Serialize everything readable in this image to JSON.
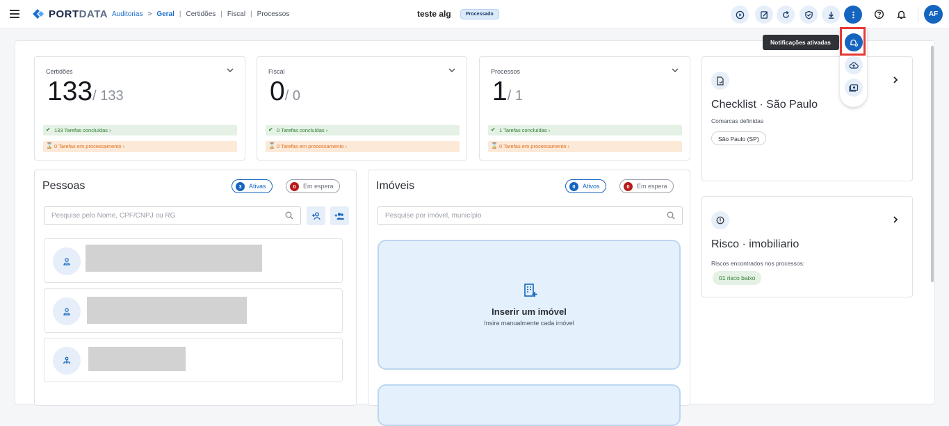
{
  "header": {
    "logo": {
      "part1": "PORT",
      "part2": "DATA"
    },
    "breadcrumb": [
      "Auditorias",
      ">",
      "Geral",
      "|",
      "Certidões",
      "|",
      "Fiscal",
      "|",
      "Processos"
    ],
    "page_title": "teste alg",
    "status_badge": "Processado",
    "avatar": "AF",
    "actions": [
      "play-icon",
      "edit-note-icon",
      "refresh-icon",
      "shield-check-icon",
      "download-icon",
      "more-vertical-icon",
      "help-icon",
      "bell-icon"
    ]
  },
  "tooltip": "Notificações ativadas",
  "stats": [
    {
      "label": "Certidões",
      "value": "133",
      "total": "/ 133",
      "done": "133 Tarefas concluídas",
      "processing": "0 Tarefas em processamento"
    },
    {
      "label": "Fiscal",
      "value": "0",
      "total": "/ 0",
      "done": "0 Tarefas concluídas",
      "processing": "0 Tarefas em processamento"
    },
    {
      "label": "Processos",
      "value": "1",
      "total": "/ 1",
      "done": "1 Tarefas concluídas",
      "processing": "0 Tarefas em processamento"
    }
  ],
  "pessoas": {
    "title": "Pessoas",
    "active_count": "3",
    "active_label": "Ativas",
    "waiting_count": "0",
    "waiting_label": "Em espera",
    "search_placeholder": "Pesquise pelo Nome, CPF/CNPJ ou RG"
  },
  "imoveis": {
    "title": "Imóveis",
    "active_count": "0",
    "active_label": "Ativos",
    "waiting_count": "0",
    "waiting_label": "Em espera",
    "search_placeholder": "Pesquise por imóvel, município",
    "insert_title": "Inserir um imóvel",
    "insert_subtitle": "Insira manualmente cada imóvel"
  },
  "checklist": {
    "title": "Checklist · São Paulo",
    "subtitle": "Comarcas definidas",
    "chip": "São Paulo (SP)"
  },
  "risco": {
    "title": "Risco · imobiliario",
    "subtitle": "Riscos encontrados nos processos:",
    "chip": "01 risco baixo"
  }
}
